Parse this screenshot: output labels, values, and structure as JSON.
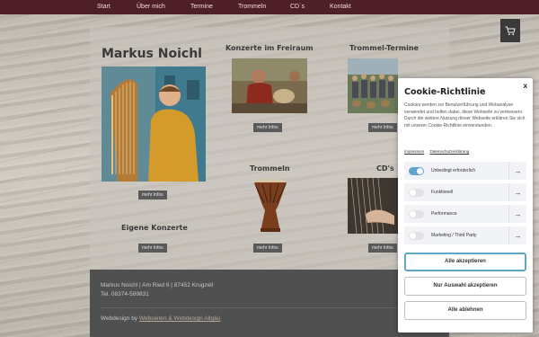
{
  "nav": [
    "Start",
    "Über mich",
    "Termine",
    "Trommeln",
    "CD´s",
    "Kontakt"
  ],
  "cart_icon": "cart-icon",
  "main": {
    "title": "Markus Noichl",
    "columns": {
      "konzerte": "Konzerte im Freiraum",
      "termine": "Trommel-Termine",
      "trommeln": "Trommeln",
      "cds": "CD's",
      "eigene": "Eigene Konzerte"
    },
    "more_label": "mehr Infos"
  },
  "footer": {
    "address": "Markus Noichl | Am Ried 6 | 87452 Krugzell",
    "phone": "Tel. 08374-589831",
    "webdesign_prefix": "Webdesign  by",
    "webdesign_link": "Webseiten & Webdesign Allgäu"
  },
  "cookie": {
    "close": "x",
    "title": "Cookie-Richtlinie",
    "description": "Cookies werden zur Benutzerführung und Webanalyse verwendet und helfen dabei, diese Webseite zu verbessern. Durch die weitere Nutzung dieser Webseite erklären Sie sich mit unserer Cookie-Richtlinie einverstanden.",
    "links": [
      "Impressum",
      "Datenschutzerklärung"
    ],
    "categories": [
      {
        "label": "Unbedingt erforderlich",
        "on": true
      },
      {
        "label": "Funktionell",
        "on": false
      },
      {
        "label": "Performance",
        "on": false
      },
      {
        "label": "Marketing / Third Party",
        "on": false
      }
    ],
    "buttons": {
      "accept_all": "Alle akzeptieren",
      "accept_selection": "Nur Auswahl akzeptieren",
      "reject_all": "Alle ablehnen"
    }
  },
  "colors": {
    "nav_bg": "#4e1f28",
    "accent": "#62a4d1",
    "footer_bg": "#505050"
  }
}
